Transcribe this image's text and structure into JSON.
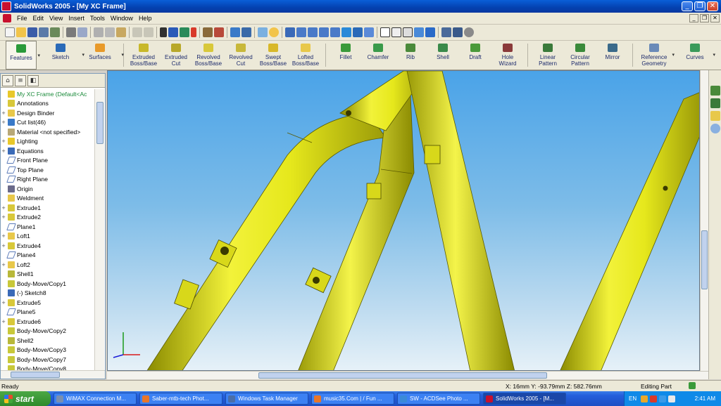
{
  "window": {
    "title": "SolidWorks 2005 - [My XC Frame]"
  },
  "menu": [
    "File",
    "Edit",
    "View",
    "Insert",
    "Tools",
    "Window",
    "Help"
  ],
  "window_buttons": {
    "minimize": "_",
    "restore": "❐",
    "close": "✕"
  },
  "command_manager": {
    "groups": [
      [
        {
          "label": "Features",
          "dropdown": true,
          "active": true
        },
        {
          "label": "Sketch",
          "dropdown": true
        },
        {
          "label": "Surfaces",
          "dropdown": true
        }
      ],
      [
        {
          "label": "Extruded\nBoss/Base"
        },
        {
          "label": "Extruded\nCut"
        },
        {
          "label": "Revolved\nBoss/Base"
        },
        {
          "label": "Revolved\nCut"
        },
        {
          "label": "Swept\nBoss/Base"
        },
        {
          "label": "Lofted\nBoss/Base"
        }
      ],
      [
        {
          "label": "Fillet"
        },
        {
          "label": "Chamfer"
        },
        {
          "label": "Rib"
        },
        {
          "label": "Shell"
        },
        {
          "label": "Draft"
        },
        {
          "label": "Hole\nWizard"
        }
      ],
      [
        {
          "label": "Linear\nPattern"
        },
        {
          "label": "Circular\nPattern"
        },
        {
          "label": "Mirror"
        }
      ],
      [
        {
          "label": "Reference\nGeometry",
          "dropdown": true
        },
        {
          "label": "Curves",
          "dropdown": true
        }
      ]
    ]
  },
  "feature_manager": {
    "root": "My XC Frame  (Default<Ac",
    "items": [
      {
        "label": "Annotations",
        "expand": "",
        "icon": "annotations-icon"
      },
      {
        "label": "Design Binder",
        "expand": "+",
        "icon": "design-binder-icon"
      },
      {
        "label": "Cut list(46)",
        "expand": "+",
        "icon": "cut-list-icon"
      },
      {
        "label": "Material <not specified>",
        "expand": "",
        "icon": "material-icon"
      },
      {
        "label": "Lighting",
        "expand": "+",
        "icon": "lighting-icon"
      },
      {
        "label": "Equations",
        "expand": "+",
        "icon": "equations-icon"
      },
      {
        "label": "Front Plane",
        "expand": "",
        "icon": "plane-icon"
      },
      {
        "label": "Top Plane",
        "expand": "",
        "icon": "plane-icon"
      },
      {
        "label": "Right Plane",
        "expand": "",
        "icon": "plane-icon"
      },
      {
        "label": "Origin",
        "expand": "",
        "icon": "origin-icon"
      },
      {
        "label": "Weldment",
        "expand": "",
        "icon": "weldment-icon"
      },
      {
        "label": "Extrude1",
        "expand": "+",
        "icon": "extrude-icon"
      },
      {
        "label": "Extrude2",
        "expand": "+",
        "icon": "extrude-icon"
      },
      {
        "label": "Plane1",
        "expand": "",
        "icon": "plane-icon"
      },
      {
        "label": "Loft1",
        "expand": "+",
        "icon": "loft-icon"
      },
      {
        "label": "Extrude4",
        "expand": "+",
        "icon": "extrude-icon"
      },
      {
        "label": "Plane4",
        "expand": "",
        "icon": "plane-icon"
      },
      {
        "label": "Loft2",
        "expand": "+",
        "icon": "loft-icon"
      },
      {
        "label": "Shell1",
        "expand": "",
        "icon": "shell-icon"
      },
      {
        "label": "Body-Move/Copy1",
        "expand": "",
        "icon": "body-move-icon"
      },
      {
        "label": "(-) Sketch8",
        "expand": "",
        "icon": "sketch-icon"
      },
      {
        "label": "Extrude5",
        "expand": "+",
        "icon": "extrude-icon"
      },
      {
        "label": "Plane5",
        "expand": "",
        "icon": "plane-icon"
      },
      {
        "label": "Extrude6",
        "expand": "+",
        "icon": "extrude-icon"
      },
      {
        "label": "Body-Move/Copy2",
        "expand": "",
        "icon": "body-move-icon"
      },
      {
        "label": "Shell2",
        "expand": "",
        "icon": "shell-icon"
      },
      {
        "label": "Body-Move/Copy3",
        "expand": "",
        "icon": "body-move-icon"
      },
      {
        "label": "Body-Move/Copy7",
        "expand": "",
        "icon": "body-move-icon"
      },
      {
        "label": "Body-Move/Copy8",
        "expand": "",
        "icon": "body-move-icon"
      }
    ]
  },
  "status": {
    "ready": "Ready",
    "coords": "X: 16mm  Y: -93.79mm  Z: 582.76mm",
    "mode": "Editing Part"
  },
  "taskbar": {
    "start": "start",
    "tasks": [
      {
        "label": "WiMAX Connection M...",
        "color": "#7a8fb0"
      },
      {
        "label": "Saber-mtb-tech Phot...",
        "color": "#e8762a"
      },
      {
        "label": "Windows Task Manager",
        "color": "#4a6ea8"
      },
      {
        "label": "music35.Com | / Fun ...",
        "color": "#e8762a"
      },
      {
        "label": "SW - ACDSee Photo ...",
        "color": "#3a8ad8"
      },
      {
        "label": "SolidWorks 2005 - [M...",
        "color": "#c8102e",
        "active": true
      }
    ],
    "lang": "EN",
    "clock": "2:41 AM"
  },
  "colors": {
    "frame_yellow": "#e6e81c",
    "viewport_sky": "#4aa3e8",
    "title_blue": "#0a5fd8"
  }
}
